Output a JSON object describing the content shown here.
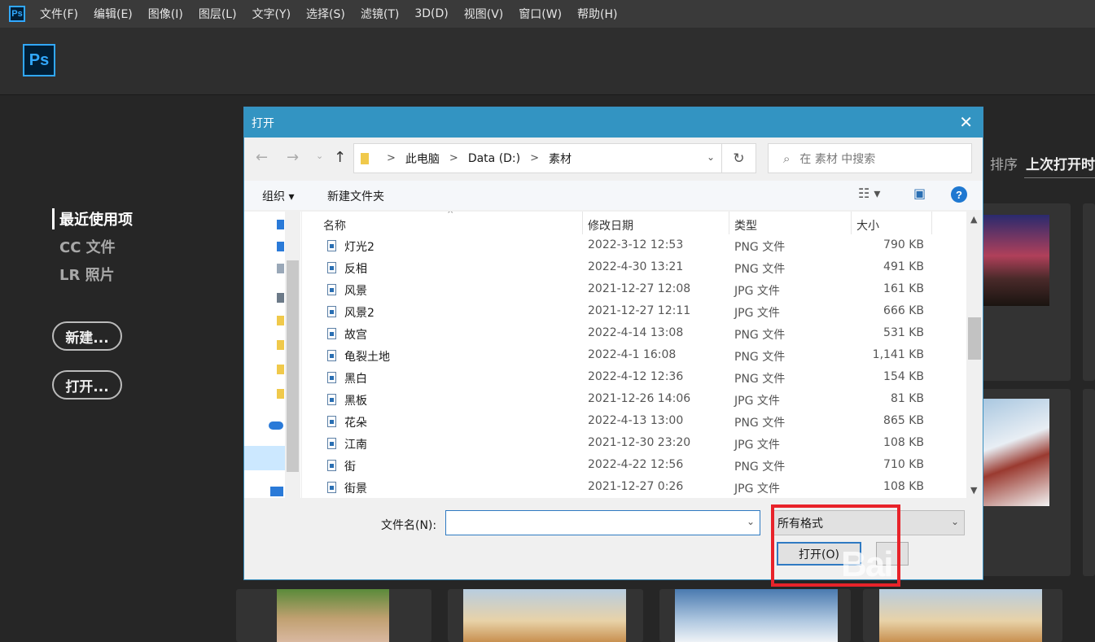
{
  "menubar": {
    "logo": "Ps",
    "items": [
      "文件(F)",
      "编辑(E)",
      "图像(I)",
      "图层(L)",
      "文字(Y)",
      "选择(S)",
      "滤镜(T)",
      "3D(D)",
      "视图(V)",
      "窗口(W)",
      "帮助(H)"
    ]
  },
  "home": {
    "logo": "Ps",
    "nav": [
      "最近使用项",
      "CC 文件",
      "LR 照片"
    ],
    "new_button": "新建...",
    "open_button": "打开...",
    "sort_label": "排序",
    "sort_value": "上次打开时"
  },
  "dialog": {
    "title": "打开",
    "breadcrumb": [
      "此电脑",
      "Data (D:)",
      "素材"
    ],
    "search_placeholder": "在 素材 中搜索",
    "organize": "组织 ▾",
    "new_folder": "新建文件夹",
    "columns": {
      "name": "名称",
      "date": "修改日期",
      "type": "类型",
      "size": "大小"
    },
    "files": [
      {
        "name": "灯光2",
        "date": "2022-3-12 12:53",
        "type": "PNG 文件",
        "size": "790 KB"
      },
      {
        "name": "反相",
        "date": "2022-4-30 13:21",
        "type": "PNG 文件",
        "size": "491 KB"
      },
      {
        "name": "风景",
        "date": "2021-12-27 12:08",
        "type": "JPG 文件",
        "size": "161 KB"
      },
      {
        "name": "风景2",
        "date": "2021-12-27 12:11",
        "type": "JPG 文件",
        "size": "666 KB"
      },
      {
        "name": "故宫",
        "date": "2022-4-14 13:08",
        "type": "PNG 文件",
        "size": "531 KB"
      },
      {
        "name": "龟裂土地",
        "date": "2022-4-1 16:08",
        "type": "PNG 文件",
        "size": "1,141 KB"
      },
      {
        "name": "黑白",
        "date": "2022-4-12 12:36",
        "type": "PNG 文件",
        "size": "154 KB"
      },
      {
        "name": "黑板",
        "date": "2021-12-26 14:06",
        "type": "JPG 文件",
        "size": "81 KB"
      },
      {
        "name": "花朵",
        "date": "2022-4-13 13:00",
        "type": "PNG 文件",
        "size": "865 KB"
      },
      {
        "name": "江南",
        "date": "2021-12-30 23:20",
        "type": "JPG 文件",
        "size": "108 KB"
      },
      {
        "name": "街",
        "date": "2022-4-22 12:56",
        "type": "PNG 文件",
        "size": "710 KB"
      },
      {
        "name": "街景",
        "date": "2021-12-27 0:26",
        "type": "JPG 文件",
        "size": "108 KB"
      }
    ],
    "filename_label": "文件名(N):",
    "filename_value": "",
    "filter_value": "所有格式",
    "open_button": "打开(O)"
  },
  "watermark": "Bai",
  "colors": {
    "ps_blue": "#31a8ff",
    "dialog_title": "#3394c2",
    "highlight": "#e8232a"
  }
}
